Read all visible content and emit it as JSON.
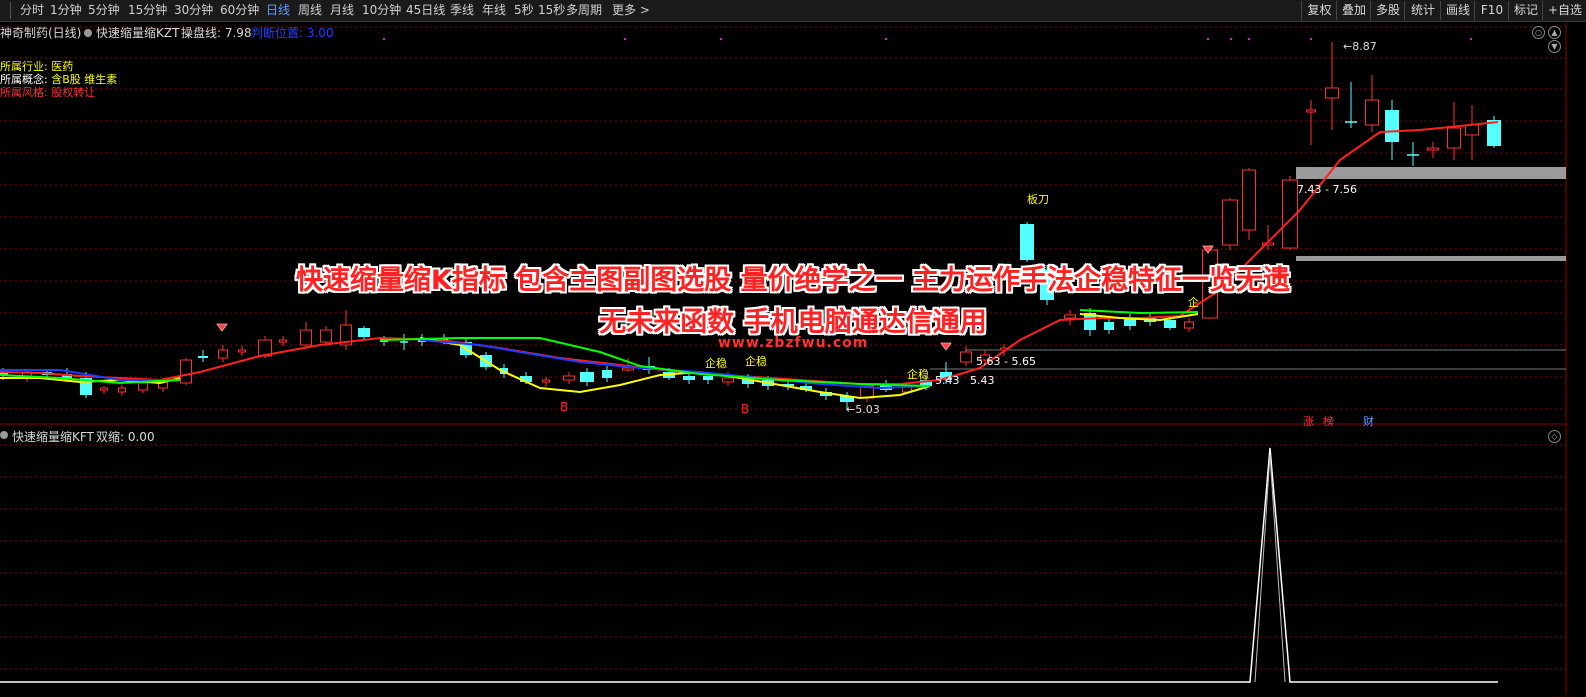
{
  "toolbar": {
    "periods": [
      "分时",
      "1分钟",
      "5分钟",
      "15分钟",
      "30分钟",
      "60分钟",
      "日线",
      "周线",
      "月线",
      "10分钟",
      "45日线",
      "季线",
      "年线",
      "5秒",
      "15秒",
      "多周期",
      "更多 >"
    ],
    "active_period": "日线",
    "right_buttons": [
      "复权",
      "叠加",
      "多股",
      "统计",
      "画线",
      "F10",
      "标记",
      "+自选"
    ]
  },
  "header": {
    "stock": "神奇制药(日线)",
    "indicator": "快速缩量缩KZT",
    "param1_label": "操盘线: 7.98",
    "param2_label": "判断位置: 3.00"
  },
  "info": {
    "industry_label": "所属行业:",
    "industry_value": "医药",
    "concept_label": "所属概念:",
    "concept_value": "含B股 维生素",
    "style_label": "所属风格:",
    "style_value": "股权转让"
  },
  "overlay": {
    "line1": "快速缩量缩K指标 包含主图副图选股 量价绝学之一 主力运作手法企稳特征一览无遗",
    "line2": "无未来函数 手机电脑通达信通用",
    "watermark": "www.zbzfwu.com"
  },
  "chart_labels": {
    "high": "8.87",
    "range1": "7.43 - 7.56",
    "range2": "5.63 - 5.65",
    "p543a": "5.43",
    "p543b": "5.43",
    "low": "5.03",
    "bandao": "板刀",
    "qiwen": "企稳",
    "qi": "企",
    "b": "B",
    "zhang": "涨",
    "bang": "榜",
    "cai": "财"
  },
  "sub": {
    "indicator": "快速缩量缩KFT",
    "value_label": "双缩: 0.00"
  },
  "colors": {
    "up": "#ff3030",
    "down": "#54ffff",
    "ma_red": "#ff2020",
    "ma_yellow": "#ffff00",
    "ma_green": "#00ff00",
    "ma_blue": "#1e3cff",
    "grid": "#8b0000"
  }
}
